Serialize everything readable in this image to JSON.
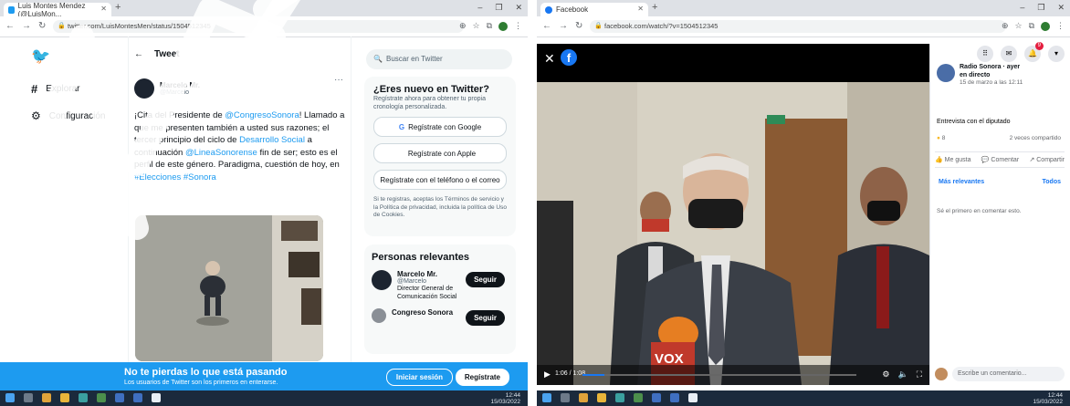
{
  "left_window": {
    "tab_title": "Luis Montes Mendez (@LuisMon...",
    "url": "twitter.com/LuisMontesMen/status/1504512345",
    "sidebar": {
      "explore": "Explorar",
      "settings": "Configuración"
    },
    "header_title": "Tweet",
    "author": {
      "name": "Marcelo Mr.",
      "handle": "@Marcelo"
    },
    "tweet": {
      "line1_pre": "¡Cita del Presidente de ",
      "line1_link": "@CongresoSonora",
      "line1_post": "!",
      "body": "Llamado a que me presenten también a usted sus razones; el tercer principio del ciclo de",
      "link2": "Desarrollo Social",
      "body2": " a continuación ",
      "link3": "@LineaSonorense",
      "body3": " fin de ser; esto es el perfil de este género.",
      "body4": "Paradigma, cuestión de hoy, en ",
      "link4": "#Elecciones",
      "link5": "#Sonora"
    },
    "search_placeholder": "Buscar en Twitter",
    "new_card": {
      "title": "¿Eres nuevo en Twitter?",
      "subtitle": "Regístrate ahora para obtener tu propia cronología personalizada.",
      "google": "Regístrate con Google",
      "apple": "Regístrate con Apple",
      "email": "Regístrate con el teléfono o el correo",
      "legal": "Si te registras, aceptas los Términos de servicio y la Política de privacidad, incluida la política de Uso de Cookies."
    },
    "people_card": {
      "title": "Personas relevantes",
      "p1_name": "Marcelo Mr.",
      "p1_handle": "@Marcelo",
      "p1_bio": "Director General de Comunicación Social",
      "p2_name": "Congreso Sonora",
      "follow": "Seguir"
    },
    "banner": {
      "title": "No te pierdas lo que está pasando",
      "subtitle": "Los usuarios de Twitter son los primeros en enterarse.",
      "login": "Iniciar sesión",
      "signup": "Regístrate"
    },
    "clock": {
      "time": "12:44",
      "date": "15/03/2022"
    }
  },
  "right_window": {
    "tab_title": "Facebook",
    "url": "facebook.com/watch/?v=1504512345",
    "video": {
      "time": "1:06 / 1:08",
      "progress_fraction": 0.08
    },
    "post": {
      "page_name": "Radio Sonora · ayer en directo",
      "date": "15 de marzo a las 12:11",
      "text": "Entrevista con el diputado",
      "reactions_count": "8",
      "shares": "2 veces compartido",
      "like": "Me gusta",
      "comment": "Comentar",
      "share": "Compartir",
      "filter": "Más relevantes",
      "filter_right": "Todos",
      "no_comments": "Sé el primero en comentar esto.",
      "composer": "Escribe un comentario..."
    },
    "clock": {
      "time": "12:44",
      "date": "15/03/2022"
    }
  },
  "colors": {
    "twitter_blue": "#1d9bf0",
    "facebook_blue": "#1877f2",
    "taskbar": "#1b2a3c"
  }
}
